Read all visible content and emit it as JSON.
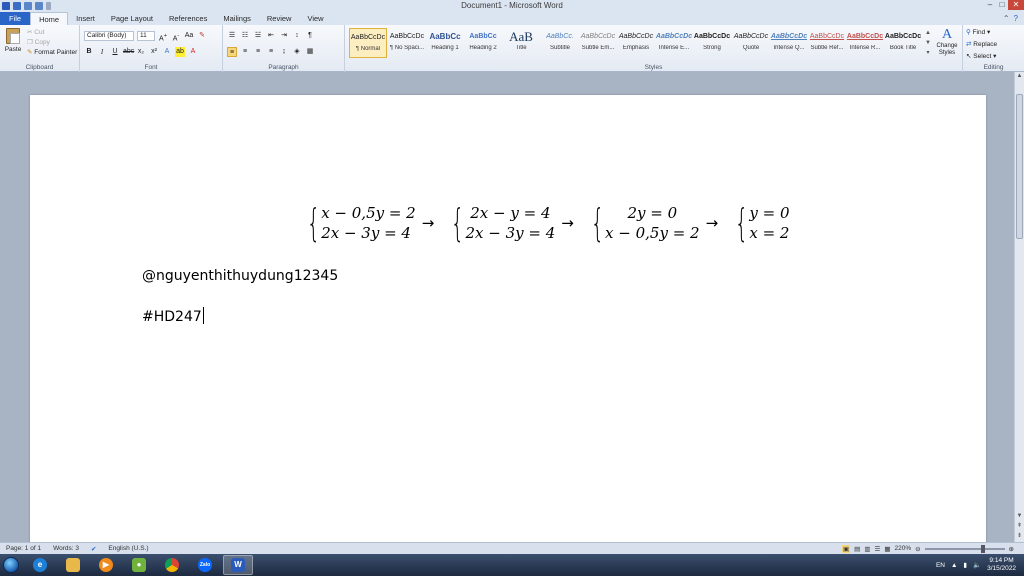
{
  "window": {
    "title": "Document1 - Microsoft Word"
  },
  "tabs": [
    "File",
    "Home",
    "Insert",
    "Page Layout",
    "References",
    "Mailings",
    "Review",
    "View"
  ],
  "active_tab": "Home",
  "ribbon": {
    "clipboard": {
      "paste": "Paste",
      "cut": "Cut",
      "copy": "Copy",
      "format_painter": "Format Painter",
      "label": "Clipboard"
    },
    "font": {
      "family": "Calibri (Body)",
      "size": "11",
      "label": "Font"
    },
    "paragraph": {
      "label": "Paragraph"
    },
    "styles": {
      "label": "Styles",
      "items": [
        {
          "preview": "AaBbCcDc",
          "name": "¶ Normal"
        },
        {
          "preview": "AaBbCcDc",
          "name": "¶ No Spaci..."
        },
        {
          "preview": "AaBbCc",
          "name": "Heading 1"
        },
        {
          "preview": "AaBbCc",
          "name": "Heading 2"
        },
        {
          "preview": "AaB",
          "name": "Title"
        },
        {
          "preview": "AaBbCc.",
          "name": "Subtitle"
        },
        {
          "preview": "AaBbCcDc",
          "name": "Subtle Em..."
        },
        {
          "preview": "AaBbCcDc",
          "name": "Emphasis"
        },
        {
          "preview": "AaBbCcDc",
          "name": "Intense E..."
        },
        {
          "preview": "AaBbCcDc",
          "name": "Strong"
        },
        {
          "preview": "AaBbCcDc",
          "name": "Quote"
        },
        {
          "preview": "AaBbCcDc",
          "name": "Intense Q..."
        },
        {
          "preview": "AaBbCcDc",
          "name": "Subtle Ref..."
        },
        {
          "preview": "AaBbCcDc",
          "name": "Intense R..."
        },
        {
          "preview": "AaBbCcDc",
          "name": "Book Title"
        }
      ],
      "change_styles": "Change Styles"
    },
    "editing": {
      "label": "Editing",
      "find": "Find",
      "replace": "Replace",
      "select": "Select"
    }
  },
  "document": {
    "equation": {
      "sys1": [
        "x − 0,5y = 2",
        "2x − 3y = 4"
      ],
      "sys2": [
        "2x − y = 4",
        "2x − 3y = 4"
      ],
      "sys3": [
        "2y = 0",
        "x − 0,5y = 2"
      ],
      "sys4": [
        "y = 0",
        "x = 2"
      ],
      "arrow": "→"
    },
    "line1": "@nguyenthithuydung12345",
    "line2": "#HD247"
  },
  "statusbar": {
    "page": "Page: 1 of 1",
    "words": "Words: 3",
    "language": "English (U.S.)",
    "zoom": "220%"
  },
  "taskbar": {
    "apps": [
      "Internet Explorer",
      "File Explorer",
      "Media Player",
      "Android Emulator",
      "Chrome",
      "Zalo",
      "Word"
    ],
    "lang": "EN",
    "time": "9:14 PM",
    "date": "3/15/2022"
  }
}
